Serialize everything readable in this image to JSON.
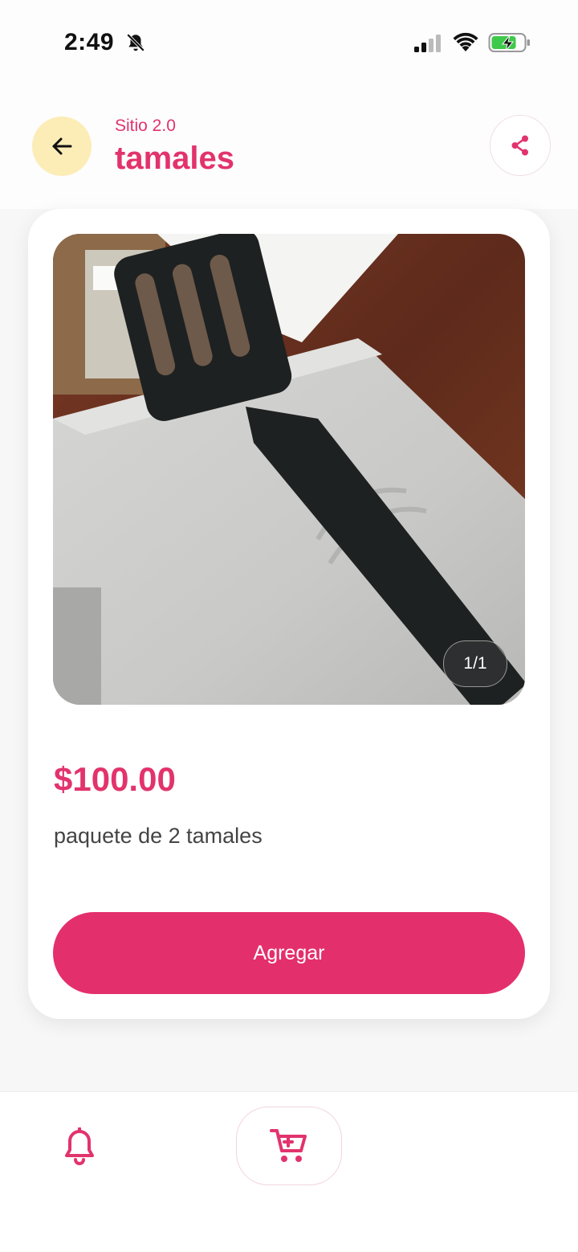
{
  "status_bar": {
    "time": "2:49",
    "icons": [
      "bell-slash-icon",
      "signal-icon",
      "wifi-icon",
      "battery-charging-icon"
    ]
  },
  "header": {
    "subtitle": "Sitio 2.0",
    "title": "tamales",
    "back_icon": "arrow-left-icon",
    "share_icon": "share-icon"
  },
  "product": {
    "image_counter": "1/1",
    "price": "$100.00",
    "description": "paquete de 2 tamales",
    "add_button_label": "Agregar"
  },
  "bottom_nav": {
    "items": [
      "bell-icon",
      "cart-icon"
    ]
  },
  "colors": {
    "accent": "#e2336d",
    "button": "#e42f6d",
    "back_button_bg": "#fcedb7"
  }
}
